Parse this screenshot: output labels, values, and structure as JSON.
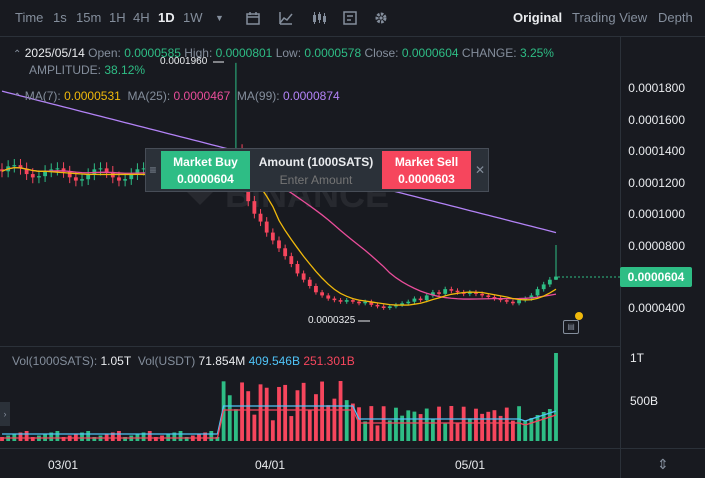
{
  "toolbar": {
    "time_label": "Time",
    "timeframes": [
      "1s",
      "15m",
      "1H",
      "4H",
      "1D",
      "1W"
    ],
    "active_timeframe": "1D",
    "views": [
      "Original",
      "Trading View",
      "Depth"
    ],
    "active_view": "Original"
  },
  "ohlc": {
    "date": "2025/05/14",
    "open_label": "Open:",
    "open": "0.0000585",
    "high_label": "High:",
    "high": "0.0000801",
    "low_label": "Low:",
    "low": "0.0000578",
    "close_label": "Close:",
    "close": "0.0000604",
    "change_label": "CHANGE:",
    "change": "3.25%",
    "amplitude_label": "AMPLITUDE:",
    "amplitude": "38.12%"
  },
  "ma": {
    "ma7_label": "MA(7):",
    "ma7": "0.0000531",
    "ma25_label": "MA(25):",
    "ma25": "0.0000467",
    "ma99_label": "MA(99):",
    "ma99": "0.0000874"
  },
  "price_axis": [
    "0.0001800",
    "0.0001600",
    "0.0001400",
    "0.0001200",
    "0.0001000",
    "0.0000800",
    "0.0000400"
  ],
  "current_price": "0.0000604",
  "annotations": {
    "high_mark": "0.0001960",
    "low_mark": "0.0000325"
  },
  "trade_panel": {
    "buy_label": "Market Buy",
    "buy_price": "0.0000604",
    "amount_label": "Amount (1000SATS)",
    "amount_placeholder": "Enter Amount",
    "sell_label": "Market Sell",
    "sell_price": "0.0000603"
  },
  "volume": {
    "vol_label": "Vol(1000SATS):",
    "vol": "1.05T",
    "vol_usdt_label": "Vol(USDT)",
    "vol_usdt": "71.854M",
    "vol_ma1": "409.546B",
    "vol_ma2": "251.301B",
    "axis": [
      "1T",
      "500B"
    ]
  },
  "dates": [
    "03/01",
    "04/01",
    "05/01"
  ],
  "colors": {
    "up": "#2ebd85",
    "down": "#f6465d",
    "ma7": "#f0b90b",
    "ma25": "#e94d9a",
    "ma99": "#b383f7",
    "vol_ma_blue": "#4fc3f7"
  },
  "chart_data": {
    "type": "candlestick",
    "price_range": [
      3e-05,
      0.000195
    ],
    "candles_summary": [
      {
        "date": "2025/05/14",
        "open": 5.85e-05,
        "high": 8.01e-05,
        "low": 5.78e-05,
        "close": 6.04e-05
      }
    ],
    "high_marker": 0.000196,
    "low_marker": 3.25e-05,
    "volume_axis": [
      "1T",
      "500B"
    ]
  }
}
